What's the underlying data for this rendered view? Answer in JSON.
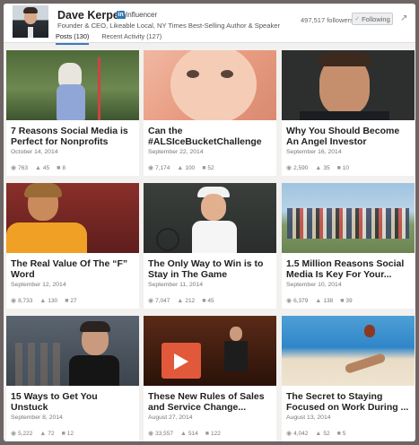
{
  "profile": {
    "name": "Dave Kerpen",
    "badge": "Influencer",
    "headline": "Founder & CEO, Likeable Local, NY Times Best-Selling Author & Speaker",
    "followers": "497,517 followers",
    "follow_button": "Following"
  },
  "tabs": [
    {
      "label": "Posts (130)",
      "active": true
    },
    {
      "label": "Recent Activity (127)",
      "active": false
    }
  ],
  "posts": [
    {
      "title": "7 Reasons Social Media is Perfect for Nonprofits",
      "date": "October 14, 2014",
      "views": "763",
      "likes": "45",
      "comments": "8"
    },
    {
      "title": "Can the #ALSIceBucketChallenge",
      "date": "September 22, 2014",
      "views": "7,174",
      "likes": "100",
      "comments": "52"
    },
    {
      "title": "Why You Should Become An Angel Investor",
      "date": "September 16, 2014",
      "views": "2,590",
      "likes": "35",
      "comments": "10"
    },
    {
      "title": "The Real Value Of The “F” Word",
      "date": "September 12, 2014",
      "views": "8,733",
      "likes": "130",
      "comments": "27"
    },
    {
      "title": "The Only Way to Win is to Stay in The Game",
      "date": "September 11, 2014",
      "views": "7,047",
      "likes": "212",
      "comments": "45"
    },
    {
      "title": "1.5 Million Reasons Social Media Is Key For Your...",
      "date": "September 10, 2014",
      "views": "6,379",
      "likes": "138",
      "comments": "39"
    },
    {
      "title": "15 Ways to Get You Unstuck",
      "date": "September 8, 2014",
      "views": "5,222",
      "likes": "72",
      "comments": "12"
    },
    {
      "title": "These New Rules of Sales and Service Change...",
      "date": "August 27, 2014",
      "views": "33,557",
      "likes": "514",
      "comments": "122"
    },
    {
      "title": "The Secret to Staying Focused on Work During ...",
      "date": "August 13, 2014",
      "views": "4,042",
      "likes": "52",
      "comments": "5"
    }
  ]
}
